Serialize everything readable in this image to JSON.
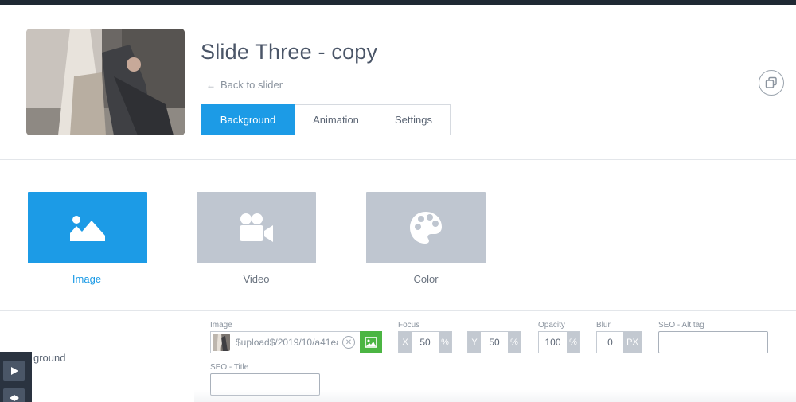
{
  "slide": {
    "title": "Slide Three - copy",
    "back_label": "Back to slider"
  },
  "tabs": [
    {
      "label": "Background",
      "active": true
    },
    {
      "label": "Animation",
      "active": false
    },
    {
      "label": "Settings",
      "active": false
    }
  ],
  "types": [
    {
      "label": "Image",
      "icon": "image-icon",
      "active": true
    },
    {
      "label": "Video",
      "icon": "video-camera-icon",
      "active": false
    },
    {
      "label": "Color",
      "icon": "palette-icon",
      "active": false
    }
  ],
  "sidebar": {
    "section_label": "ground"
  },
  "fields": {
    "image": {
      "label": "Image",
      "value": "$upload$/2019/10/a41ea"
    },
    "focus": {
      "label": "Focus",
      "x_prefix": "X",
      "x_value": "50",
      "y_prefix": "Y",
      "y_value": "50",
      "unit": "%"
    },
    "opacity": {
      "label": "Opacity",
      "value": "100",
      "unit": "%"
    },
    "blur": {
      "label": "Blur",
      "value": "0",
      "unit": "PX"
    },
    "seo_alt": {
      "label": "SEO - Alt tag",
      "value": ""
    },
    "seo_title": {
      "label": "SEO - Title",
      "value": ""
    }
  },
  "colors": {
    "accent": "#1c9be6",
    "inactive_card": "#bfc6d0",
    "pick_button": "#4bb543",
    "toolbar": "#2a3340"
  }
}
